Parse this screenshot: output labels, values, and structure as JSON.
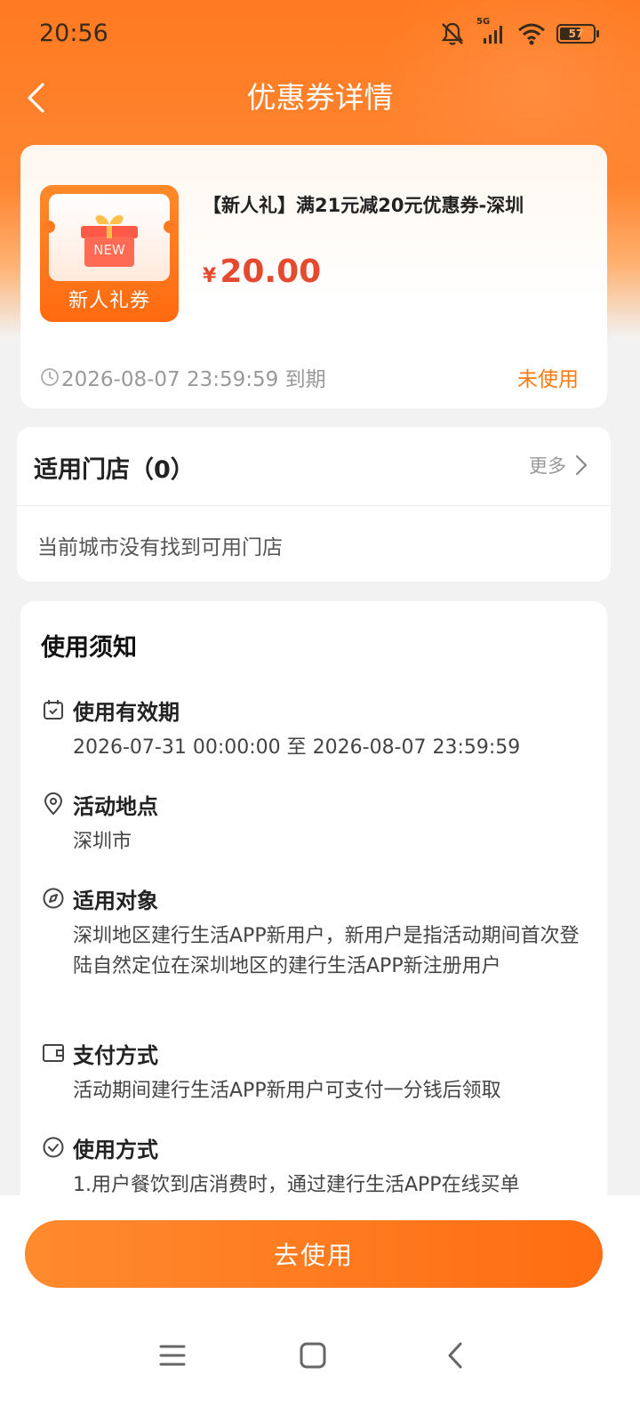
{
  "status_bar": {
    "time": "20:56",
    "network": "5G",
    "battery": "57"
  },
  "nav": {
    "title": "优惠券详情"
  },
  "coupon": {
    "thumb_badge": "NEW",
    "thumb_label": "新人礼券",
    "title": "【新人礼】满21元减20元优惠券-深圳",
    "currency": "¥",
    "price": "20.00",
    "expiry": "2026-08-07 23:59:59 到期",
    "status": "未使用"
  },
  "stores": {
    "title": "适用门店（0）",
    "more_label": "更多",
    "empty_text": "当前城市没有找到可用门店"
  },
  "notice": {
    "title": "使用须知",
    "sections": [
      {
        "icon": "calendar-icon",
        "label": "使用有效期",
        "body": "2026-07-31 00:00:00 至 2026-08-07 23:59:59"
      },
      {
        "icon": "location-pin-icon",
        "label": "活动地点",
        "body": "深圳市"
      },
      {
        "icon": "compass-icon",
        "label": "适用对象",
        "body": "深圳地区建行生活APP新用户，新用户是指活动期间首次登陆自然定位在深圳地区的建行生活APP新注册用户"
      },
      {
        "icon": "wallet-icon",
        "label": "支付方式",
        "body": "活动期间建行生活APP新用户可支付一分钱后领取"
      },
      {
        "icon": "check-circle-icon",
        "label": "使用方式",
        "body": "1.用户餐饮到店消费时，通过建行生活APP在线买单"
      }
    ]
  },
  "footer": {
    "button_label": "去使用"
  },
  "colors": {
    "brand_orange": "#ff7a22",
    "price_red": "#e64a2e",
    "status_orange": "#ff7a12"
  }
}
